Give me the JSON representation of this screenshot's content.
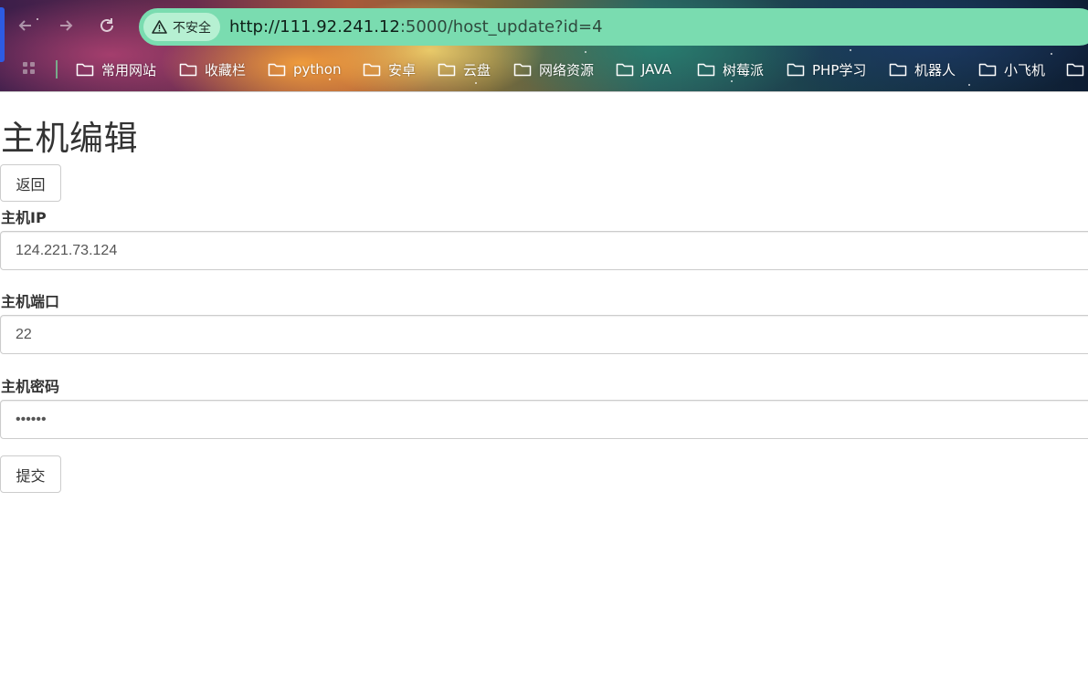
{
  "browser": {
    "security_label": "不安全",
    "url_host": "http://111.92.241.12",
    "url_path": ":5000/host_update?id=4",
    "omnibox_color": "#7adcb0",
    "bookmarks": [
      {
        "label": "常用网站",
        "icon": "folder-icon"
      },
      {
        "label": "收藏栏",
        "icon": "folder-icon"
      },
      {
        "label": "python",
        "icon": "folder-icon"
      },
      {
        "label": "安卓",
        "icon": "folder-icon"
      },
      {
        "label": "云盘",
        "icon": "folder-icon"
      },
      {
        "label": "网络资源",
        "icon": "folder-icon"
      },
      {
        "label": "JAVA",
        "icon": "folder-icon"
      },
      {
        "label": "树莓派",
        "icon": "folder-icon"
      },
      {
        "label": "PHP学习",
        "icon": "folder-icon"
      },
      {
        "label": "机器人",
        "icon": "folder-icon"
      },
      {
        "label": "小飞机",
        "icon": "folder-icon"
      },
      {
        "label": "",
        "icon": "folder-icon"
      }
    ]
  },
  "page": {
    "title": "主机编辑",
    "back_button": "返回",
    "fields": {
      "ip": {
        "label": "主机IP",
        "value": "124.221.73.124"
      },
      "port": {
        "label": "主机端口",
        "value": "22"
      },
      "password": {
        "label": "主机密码",
        "value": "••••••"
      }
    },
    "submit_button": "提交"
  }
}
